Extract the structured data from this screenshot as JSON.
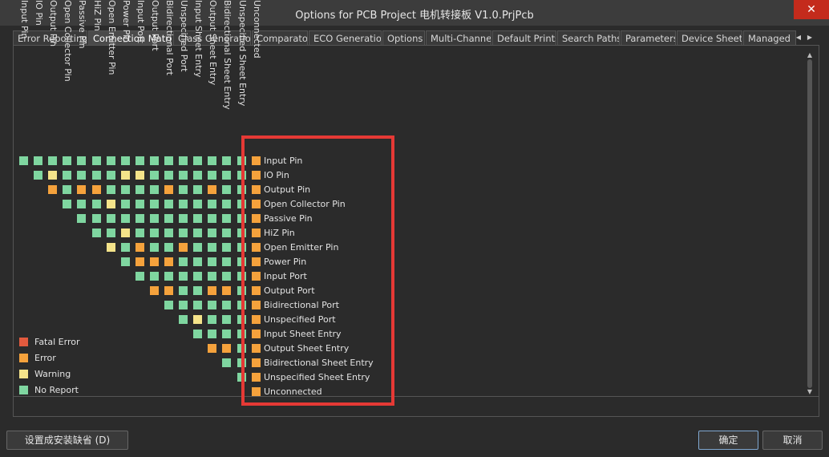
{
  "window": {
    "title": "Options for PCB Project 电机转接板 V1.0.PrjPcb",
    "close_glyph": "✕"
  },
  "tabs": [
    {
      "label": "Error Reporting",
      "active": false
    },
    {
      "label": "Connection Matrix",
      "active": true
    },
    {
      "label": "Class Generation",
      "active": false
    },
    {
      "label": "Comparator",
      "active": false
    },
    {
      "label": "ECO Generation",
      "active": false
    },
    {
      "label": "Options",
      "active": false
    },
    {
      "label": "Multi-Channel",
      "active": false
    },
    {
      "label": "Default Prints",
      "active": false
    },
    {
      "label": "Search Paths",
      "active": false
    },
    {
      "label": "Parameters",
      "active": false
    },
    {
      "label": "Device Sheets",
      "active": false
    },
    {
      "label": "Managed",
      "active": false
    }
  ],
  "tab_scroll": {
    "left_icon": "◀",
    "right_icon": "▶"
  },
  "scrollbar": {
    "up_icon": "▲",
    "down_icon": "▼"
  },
  "matrix": {
    "labels": [
      "Input Pin",
      "IO Pin",
      "Output Pin",
      "Open Collector Pin",
      "Passive Pin",
      "HiZ Pin",
      "Open Emitter Pin",
      "Power Pin",
      "Input Port",
      "Output Port",
      "Bidirectional Port",
      "Unspecified Port",
      "Input Sheet Entry",
      "Output Sheet Entry",
      "Bidirectional Sheet Entry",
      "Unspecified Sheet Entry",
      "Unconnected"
    ],
    "rows": [
      [
        "N",
        "N",
        "N",
        "N",
        "N",
        "N",
        "N",
        "N",
        "N",
        "N",
        "N",
        "N",
        "N",
        "N",
        "N",
        "N",
        "E"
      ],
      [
        "N",
        "W",
        "N",
        "N",
        "N",
        "N",
        "W",
        "W",
        "N",
        "N",
        "N",
        "N",
        "N",
        "N",
        "N",
        "E"
      ],
      [
        "E",
        "N",
        "E",
        "E",
        "N",
        "N",
        "N",
        "N",
        "E",
        "N",
        "N",
        "E",
        "N",
        "N",
        "E"
      ],
      [
        "N",
        "N",
        "N",
        "W",
        "N",
        "N",
        "N",
        "N",
        "N",
        "N",
        "N",
        "N",
        "N",
        "E"
      ],
      [
        "N",
        "N",
        "N",
        "N",
        "N",
        "N",
        "N",
        "N",
        "N",
        "N",
        "N",
        "N",
        "E"
      ],
      [
        "N",
        "N",
        "W",
        "N",
        "N",
        "N",
        "N",
        "N",
        "N",
        "N",
        "N",
        "E"
      ],
      [
        "W",
        "N",
        "E",
        "N",
        "N",
        "E",
        "N",
        "N",
        "N",
        "N",
        "E"
      ],
      [
        "N",
        "E",
        "E",
        "E",
        "N",
        "N",
        "N",
        "N",
        "N",
        "E"
      ],
      [
        "N",
        "N",
        "N",
        "N",
        "N",
        "N",
        "N",
        "N",
        "E"
      ],
      [
        "E",
        "E",
        "N",
        "N",
        "E",
        "E",
        "N",
        "E"
      ],
      [
        "N",
        "N",
        "N",
        "N",
        "N",
        "N",
        "E"
      ],
      [
        "N",
        "W",
        "N",
        "N",
        "N",
        "E"
      ],
      [
        "N",
        "N",
        "N",
        "N",
        "E"
      ],
      [
        "E",
        "E",
        "N",
        "E"
      ],
      [
        "N",
        "N",
        "E"
      ],
      [
        "N",
        "E"
      ],
      [
        "E"
      ]
    ]
  },
  "legend": [
    {
      "label": "Fatal Error",
      "color": "#e25a3e"
    },
    {
      "label": "Error",
      "color": "#f5a23c"
    },
    {
      "label": "Warning",
      "color": "#f4e38a"
    },
    {
      "label": "No Report",
      "color": "#7fd6a0"
    }
  ],
  "colors": {
    "F": "#e25a3e",
    "E": "#f5a23c",
    "W": "#f4e38a",
    "N": "#7fd6a0",
    "highlight": "#e53935"
  },
  "buttons": {
    "set_default": "设置成安装缺省 (D)",
    "ok": "确定",
    "cancel": "取消"
  }
}
